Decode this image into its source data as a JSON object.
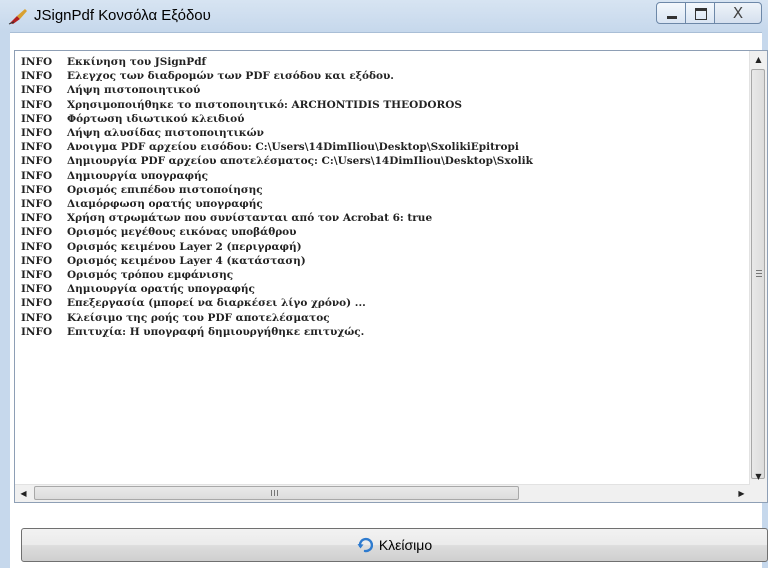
{
  "window": {
    "title": "JSignPdf Κονσόλα Εξόδου",
    "close_glyph": "X"
  },
  "log": {
    "lines": [
      {
        "level": "INFO",
        "message": "Εκκίνηση του JSignPdf"
      },
      {
        "level": "INFO",
        "message": "Ελεγχος των διαδρομών των PDF εισόδου και εξόδου."
      },
      {
        "level": "INFO",
        "message": "Λήψη πιστοποιητικού"
      },
      {
        "level": "INFO",
        "message": "Χρησιμοποιήθηκε το πιστοποιητικό: ARCHONTIDIS THEODOROS"
      },
      {
        "level": "INFO",
        "message": "Φόρτωση ιδιωτικού κλειδιού"
      },
      {
        "level": "INFO",
        "message": "Λήψη αλυσίδας πιστοποιητικών"
      },
      {
        "level": "INFO",
        "message": "Ανοιγμα PDF αρχείου εισόδου: C:\\Users\\14DimIliou\\Desktop\\SxolikiEpitropi"
      },
      {
        "level": "INFO",
        "message": "Δημιουργία PDF αρχείου αποτελέσματος: C:\\Users\\14DimIliou\\Desktop\\Sxolik"
      },
      {
        "level": "INFO",
        "message": "Δημιουργία υπογραφής"
      },
      {
        "level": "INFO",
        "message": "Ορισμός επιπέδου πιστοποίησης"
      },
      {
        "level": "INFO",
        "message": "Διαμόρφωση ορατής υπογραφής"
      },
      {
        "level": "INFO",
        "message": "Χρήση στρωμάτων που συνίστανται από τον Acrobat 6: true"
      },
      {
        "level": "INFO",
        "message": "Ορισμός μεγέθους εικόνας υποβάθρου"
      },
      {
        "level": "INFO",
        "message": "Ορισμός κειμένου Layer 2 (περιγραφή)"
      },
      {
        "level": "INFO",
        "message": "Ορισμός κειμένου Layer 4 (κατάσταση)"
      },
      {
        "level": "INFO",
        "message": "Ορισμός τρόπου εμφάνισης"
      },
      {
        "level": "INFO",
        "message": "Δημιουργία ορατής υπογραφής"
      },
      {
        "level": "INFO",
        "message": "Επεξεργασία (μπορεί να διαρκέσει λίγο χρόνο) ..."
      },
      {
        "level": "INFO",
        "message": "Κλείσιμο της ροής του PDF αποτελέσματος"
      },
      {
        "level": "INFO",
        "message": "Επιτυχία: Η υπογραφή δημιουργήθηκε επιτυχώς."
      }
    ]
  },
  "scrollbar": {
    "h_grip_glyph": "III"
  },
  "footer": {
    "close_label": "Κλείσιμο"
  }
}
